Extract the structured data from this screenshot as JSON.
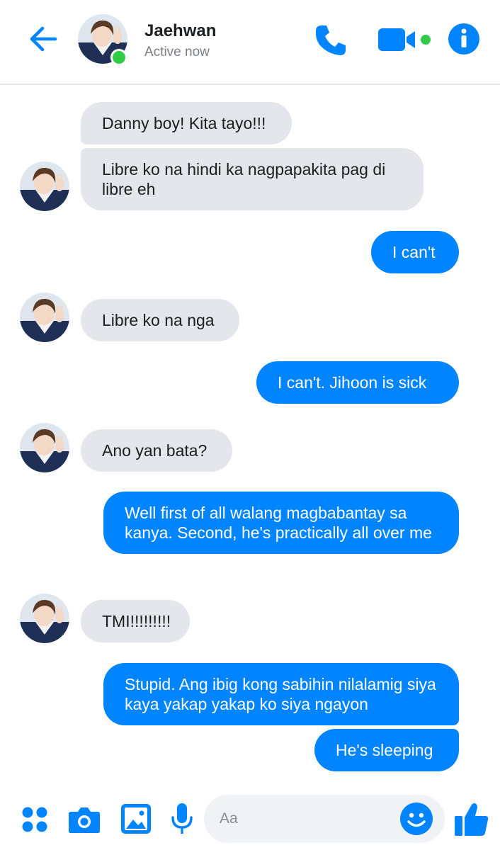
{
  "header": {
    "contact_name": "Jaehwan",
    "status": "Active now",
    "icons": {
      "back": "back-arrow-icon",
      "call": "phone-icon",
      "video": "video-camera-icon",
      "info": "info-icon"
    },
    "colors": {
      "accent": "#0084ff",
      "online": "#31cc46"
    }
  },
  "messages": [
    {
      "sender": "them",
      "text": "Danny boy! Kita tayo!!!"
    },
    {
      "sender": "them",
      "text": "Libre ko na hindi ka nagpapakita pag di libre eh"
    },
    {
      "sender": "me",
      "text": "I can't"
    },
    {
      "sender": "them",
      "text": "Libre ko na nga"
    },
    {
      "sender": "me",
      "text": "I can't. Jihoon is sick"
    },
    {
      "sender": "them",
      "text": "Ano yan bata?"
    },
    {
      "sender": "me",
      "text": "Well first of all walang magbabantay sa kanya. Second, he's practically all over me"
    },
    {
      "sender": "them",
      "text": "TMI!!!!!!!!!"
    },
    {
      "sender": "me",
      "text": "Stupid. Ang ibig kong sabihin nilalamig siya kaya yakap yakap ko siya ngayon"
    },
    {
      "sender": "me",
      "text": "He's sleeping"
    }
  ],
  "composer": {
    "placeholder": "Aa",
    "icons": [
      "menu-dots-icon",
      "camera-icon",
      "gallery-icon",
      "microphone-icon",
      "emoji-icon",
      "thumbs-up-icon"
    ]
  },
  "colors": {
    "incoming_bubble": "#e4e6eb",
    "outgoing_bubble": "#0084ff"
  }
}
